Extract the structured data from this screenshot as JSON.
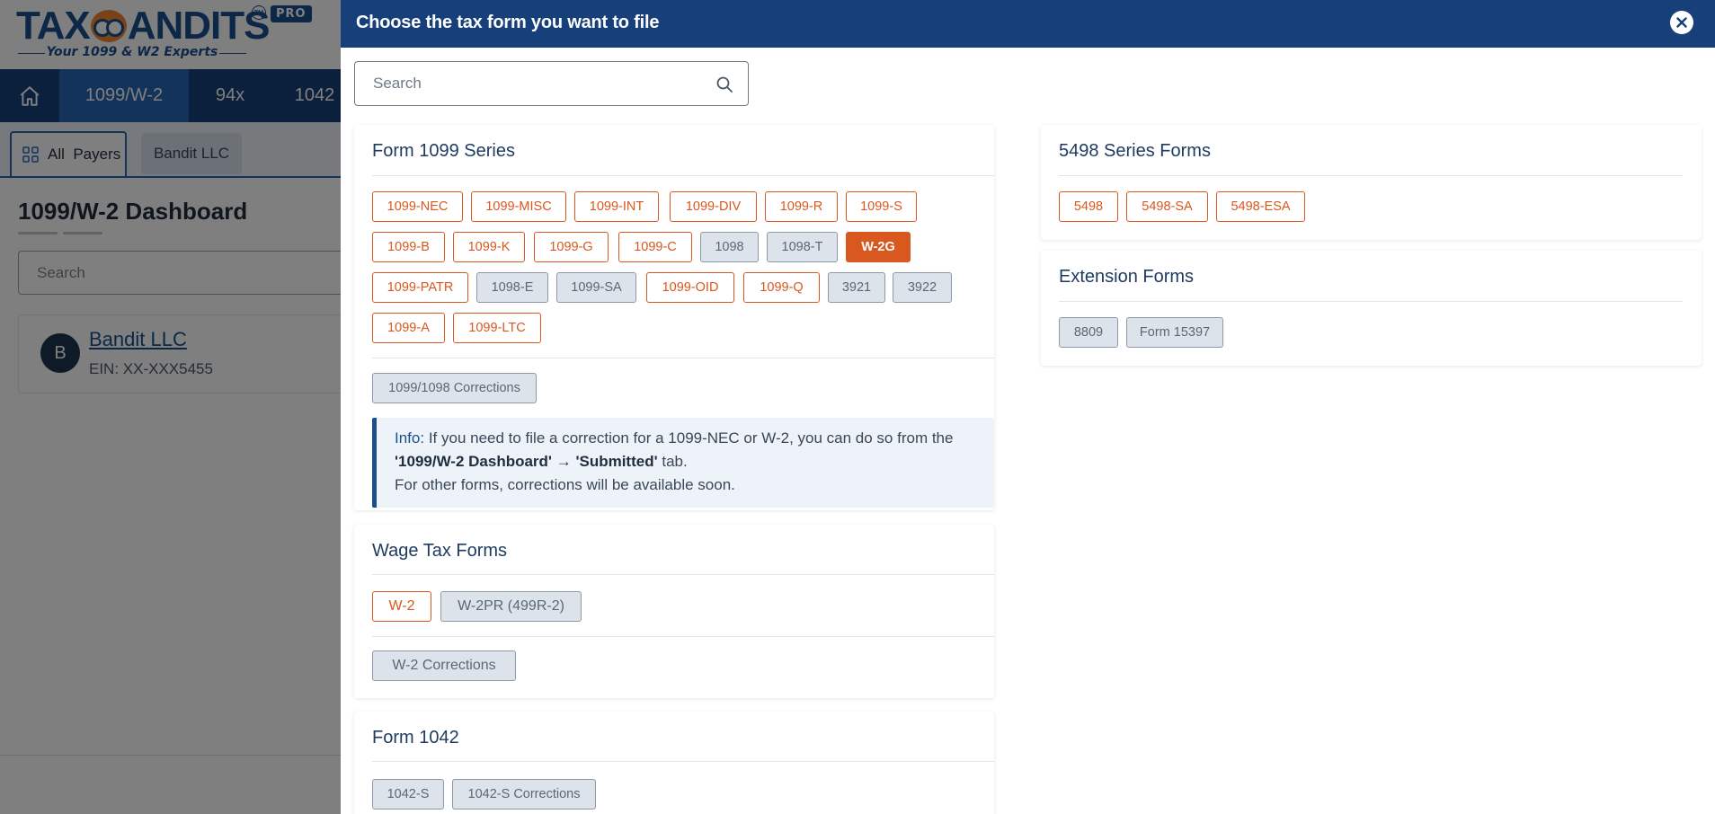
{
  "background": {
    "logo": {
      "main": "TAX  ANDITS",
      "tm": "TM",
      "badge": "PRO",
      "tagline": "Your 1099 & W2 Experts"
    },
    "nav": {
      "tabs": [
        "1099/W-2",
        "94x",
        "1042"
      ]
    },
    "payer_bar": {
      "all_payers": "All  Payers",
      "payer_tab": "Bandit LLC"
    },
    "dashboard_title": "1099/W-2 Dashboard",
    "search_placeholder": "Search",
    "payer_card": {
      "initial": "B",
      "name": "Bandit LLC",
      "ein": "EIN: XX-XXX5455"
    }
  },
  "panel": {
    "title": "Choose the tax form you want to file",
    "search_placeholder": "Search",
    "form_1099_series": {
      "title": "Form 1099 Series",
      "forms": [
        {
          "label": "1099-NEC",
          "style": "orange"
        },
        {
          "label": "1099-MISC",
          "style": "orange"
        },
        {
          "label": "1099-INT",
          "style": "orange"
        },
        {
          "label": "1099-DIV",
          "style": "orange"
        },
        {
          "label": "1099-R",
          "style": "orange"
        },
        {
          "label": "1099-S",
          "style": "orange"
        },
        {
          "label": "1099-B",
          "style": "orange"
        },
        {
          "label": "1099-K",
          "style": "orange"
        },
        {
          "label": "1099-G",
          "style": "orange"
        },
        {
          "label": "1099-C",
          "style": "orange"
        },
        {
          "label": "1098",
          "style": "grey"
        },
        {
          "label": "1098-T",
          "style": "grey"
        },
        {
          "label": "W-2G",
          "style": "filled"
        },
        {
          "label": "1099-PATR",
          "style": "orange"
        },
        {
          "label": "1098-E",
          "style": "grey"
        },
        {
          "label": "1099-SA",
          "style": "grey"
        },
        {
          "label": "1099-OID",
          "style": "orange"
        },
        {
          "label": "1099-Q",
          "style": "orange"
        },
        {
          "label": "3921",
          "style": "grey"
        },
        {
          "label": "3922",
          "style": "grey"
        },
        {
          "label": "1099-A",
          "style": "orange"
        },
        {
          "label": "1099-LTC",
          "style": "orange"
        }
      ],
      "corrections_label": "1099/1098 Corrections",
      "info": {
        "label": "Info:",
        "text1": " If you need to file a correction for a 1099-NEC or W-2, you can do so from the",
        "dashboard": "'1099/W-2 Dashboard'",
        "arrow": "→",
        "submitted": "'Submitted'",
        "text2": " tab.",
        "text3": "For other forms, corrections will be available soon."
      }
    },
    "wage_tax_forms": {
      "title": "Wage Tax Forms",
      "forms": [
        {
          "label": "W-2",
          "style": "orange"
        },
        {
          "label": "W-2PR (499R-2)",
          "style": "grey"
        }
      ],
      "corrections_label": "W-2 Corrections"
    },
    "form_1042": {
      "title": "Form 1042",
      "forms": [
        {
          "label": "1042-S",
          "style": "grey"
        },
        {
          "label": "1042-S Corrections",
          "style": "grey"
        }
      ]
    },
    "series_5498": {
      "title": "5498 Series Forms",
      "forms": [
        {
          "label": "5498",
          "style": "orange"
        },
        {
          "label": "5498-SA",
          "style": "orange"
        },
        {
          "label": "5498-ESA",
          "style": "orange"
        }
      ]
    },
    "extension_forms": {
      "title": "Extension Forms",
      "forms": [
        {
          "label": "8809",
          "style": "grey"
        },
        {
          "label": "Form 15397",
          "style": "grey"
        }
      ]
    }
  },
  "colors": {
    "navy": "#17407a",
    "accent_orange": "#d9581f",
    "grey_chip": "#dde3ea",
    "info_bg": "#eef3fa"
  }
}
